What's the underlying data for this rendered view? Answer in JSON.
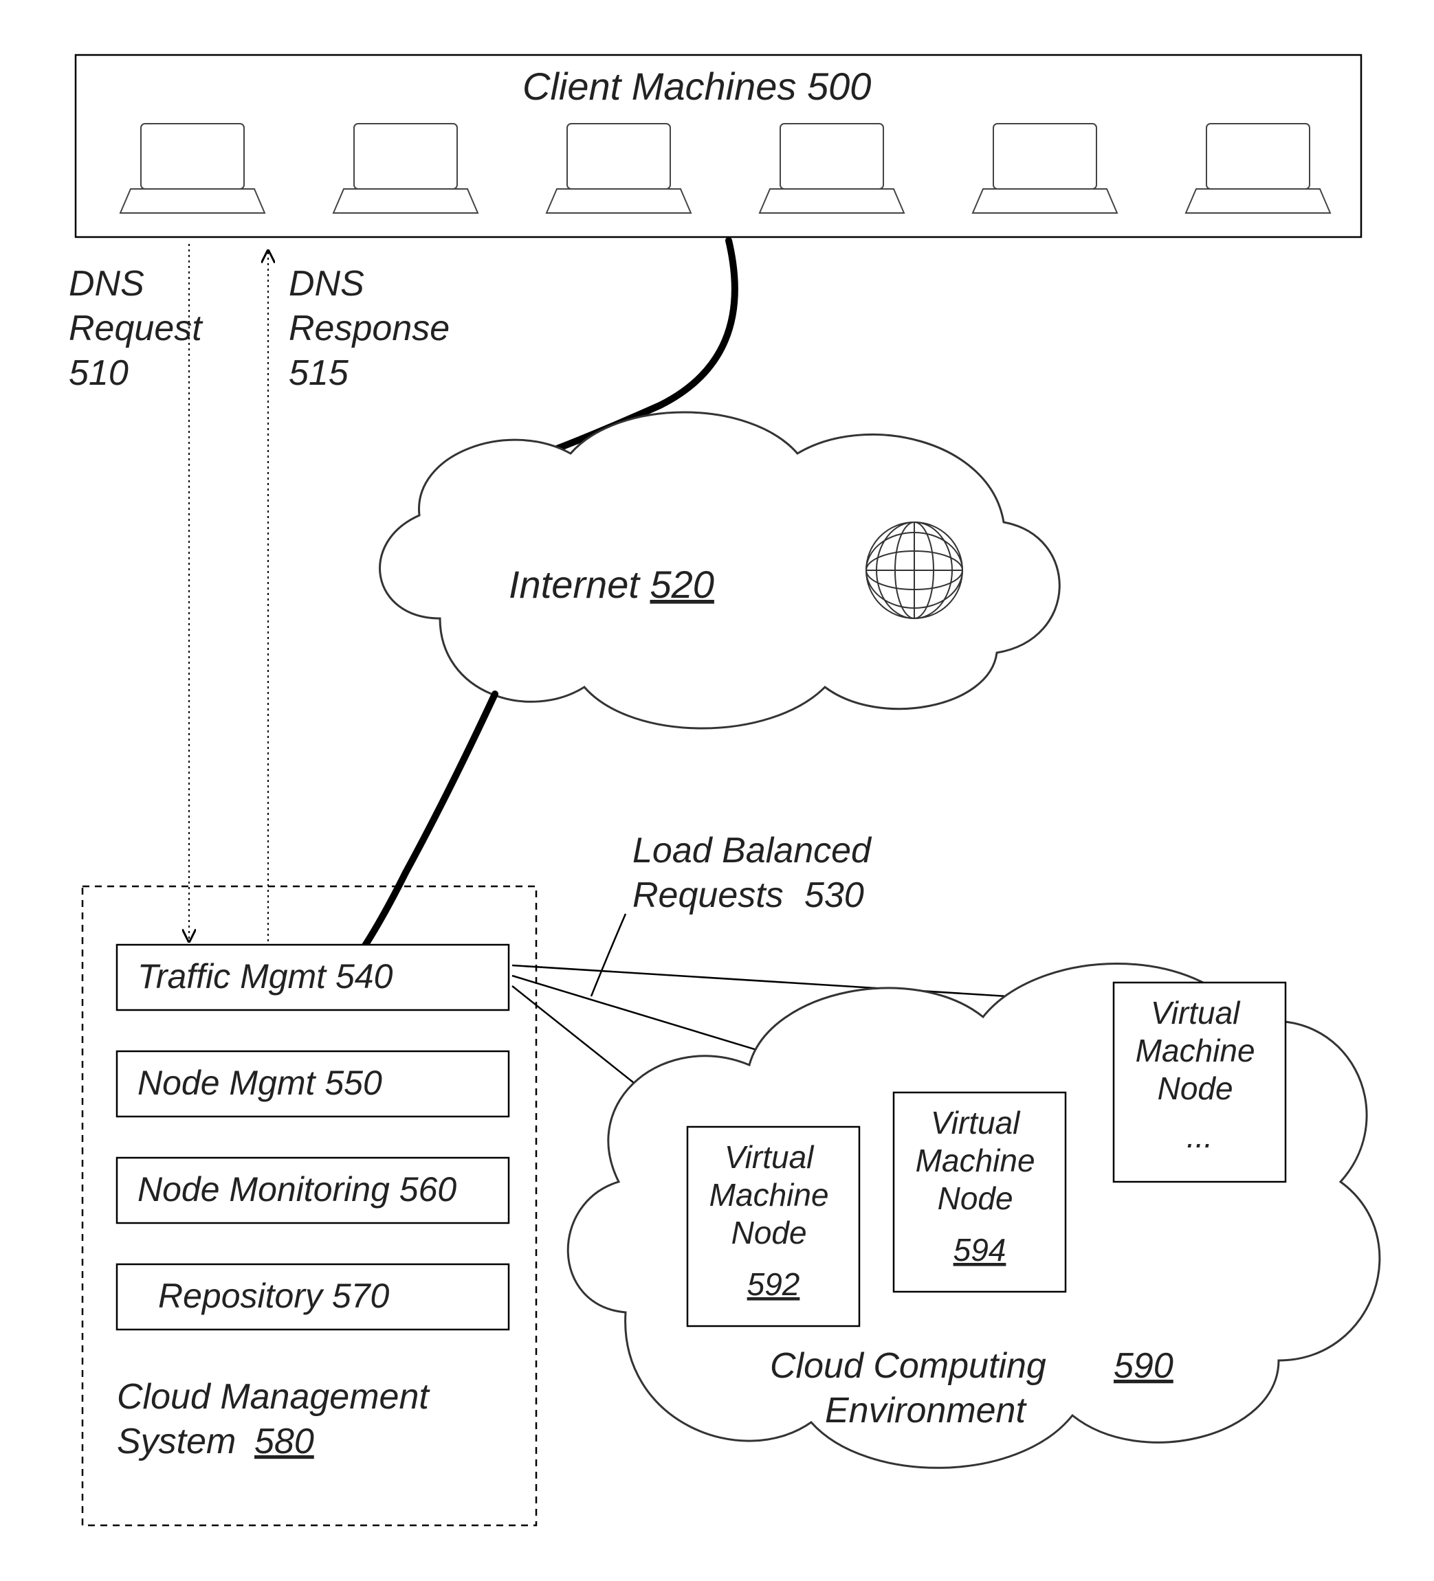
{
  "client": {
    "label": "Client Machines",
    "num": "500"
  },
  "dns_req": {
    "label1": "DNS",
    "label2": "Request",
    "num": "510"
  },
  "dns_resp": {
    "label1": "DNS",
    "label2": "Response",
    "num": "515"
  },
  "internet": {
    "label": "Internet",
    "num": "520"
  },
  "lbreq": {
    "label1": "Load Balanced",
    "label2": "Requests",
    "num": "530"
  },
  "traffic": {
    "label": "Traffic Mgmt",
    "num": "540"
  },
  "nodemgmt": {
    "label": "Node Mgmt",
    "num": "550"
  },
  "nodemon": {
    "label": "Node Monitoring",
    "num": "560"
  },
  "repo": {
    "label": "Repository",
    "num": "570"
  },
  "cms": {
    "label1": "Cloud Management",
    "label2": "System",
    "num": "580"
  },
  "cloudenv": {
    "label1": "Cloud Computing",
    "label2": "Environment",
    "num": "590"
  },
  "vm1": {
    "label1": "Virtual",
    "label2": "Machine",
    "label3": "Node",
    "num": "592"
  },
  "vm2": {
    "label1": "Virtual",
    "label2": "Machine",
    "label3": "Node",
    "num": "594"
  },
  "vm3": {
    "label1": "Virtual",
    "label2": "Machine",
    "label3": "Node",
    "num": "..."
  }
}
